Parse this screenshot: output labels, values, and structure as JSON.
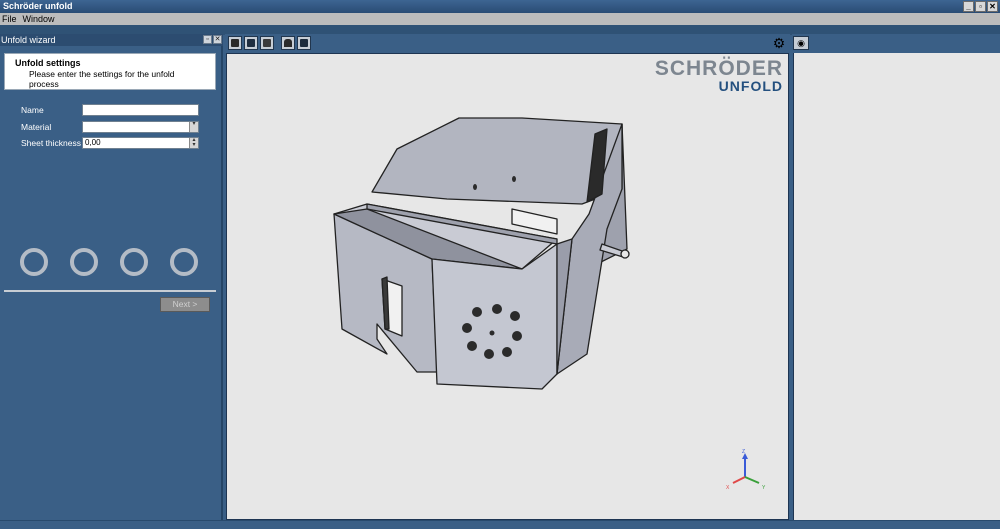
{
  "window": {
    "title": "Schröder unfold",
    "controls": [
      "_",
      "▫",
      "✕"
    ]
  },
  "menu": {
    "items": [
      "File",
      "Window"
    ]
  },
  "wizard": {
    "header": "Unfold wizard",
    "settings_title": "Unfold settings",
    "settings_subtitle": "Please enter the settings for the unfold process",
    "fields": {
      "name_label": "Name",
      "name_value": "",
      "material_label": "Material",
      "material_value": "",
      "thickness_label": "Sheet thickness",
      "thickness_value": "0,00"
    },
    "step_count": 4,
    "next_label": "Next >"
  },
  "viewport": {
    "logo_top": "SCHRÖDER",
    "logo_bottom": "UNFOLD",
    "axes": {
      "z": "Z",
      "x": "X",
      "y": "Y"
    },
    "colors": {
      "background": "#e7e7e7",
      "part": "#b4b7c2",
      "axis_z": "#3a5bd8",
      "axis_x": "#e04848",
      "axis_y": "#3aa03a"
    }
  },
  "icons": [
    "view-iso-icon",
    "view-front-icon",
    "view-side-icon",
    "view-home-icon",
    "view-cube-icon",
    "settings-gear-icon",
    "eye-icon"
  ]
}
